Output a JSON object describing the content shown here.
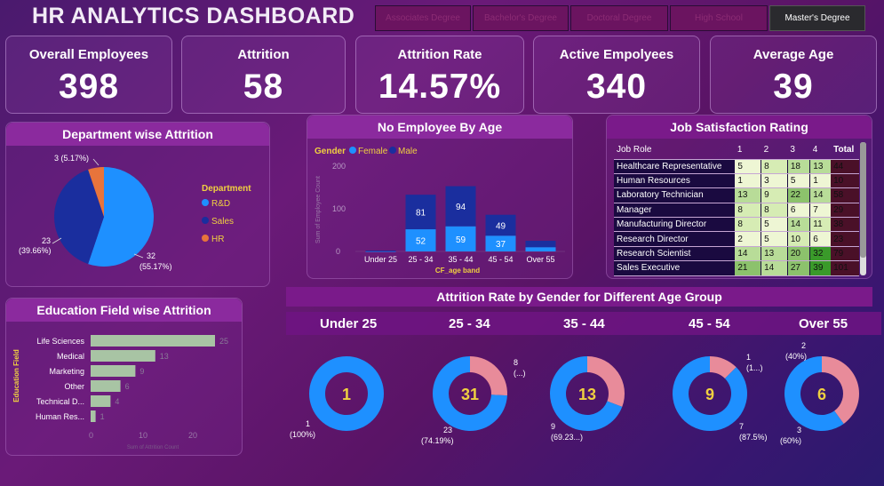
{
  "title": "HR ANALYTICS DASHBOARD",
  "slicers": [
    "Associates Degree",
    "Bachelor's Degree",
    "Doctoral Degree",
    "High School",
    "Master's Degree"
  ],
  "kpis": [
    {
      "label": "Overall Employees",
      "value": "398"
    },
    {
      "label": "Attrition",
      "value": "58"
    },
    {
      "label": "Attrition Rate",
      "value": "14.57%"
    },
    {
      "label": "Active Empolyees",
      "value": "340"
    },
    {
      "label": "Average Age",
      "value": "39"
    }
  ],
  "colors": {
    "rd": "#1e90ff",
    "sales": "#1a2e9e",
    "hr": "#e8743b",
    "female": "#1e90ff",
    "male": "#1a2e9e",
    "attr_yes": "#e88b9a",
    "attr_no": "#1e90ff"
  },
  "dept": {
    "title": "Department wise Attrition",
    "legend_title": "Department",
    "legend": [
      "R&D",
      "Sales",
      "HR"
    ],
    "labels": {
      "rd": "32",
      "rd_pct": "(55.17%)",
      "sales": "23",
      "sales_pct": "(39.66%)",
      "hr": "3 (5.17%)"
    }
  },
  "age": {
    "title": "No Employee By Age",
    "legend_title": "Gender",
    "legend": [
      "Female",
      "Male"
    ],
    "ylabel": "Sum of Employee Count",
    "xlabel": "CF_age band",
    "ticks": [
      "0",
      "100",
      "200"
    ]
  },
  "job": {
    "title": "Job Satisfaction Rating",
    "headers": [
      "Job Role",
      "1",
      "2",
      "3",
      "4",
      "Total"
    ],
    "rows": [
      {
        "role": "Healthcare Representative",
        "v": [
          "5",
          "8",
          "18",
          "13"
        ],
        "t": "44"
      },
      {
        "role": "Human Resources",
        "v": [
          "1",
          "3",
          "5",
          "1"
        ],
        "t": "10"
      },
      {
        "role": "Laboratory Technician",
        "v": [
          "13",
          "9",
          "22",
          "14"
        ],
        "t": "58"
      },
      {
        "role": "Manager",
        "v": [
          "8",
          "8",
          "6",
          "7"
        ],
        "t": "29"
      },
      {
        "role": "Manufacturing Director",
        "v": [
          "8",
          "5",
          "14",
          "11"
        ],
        "t": "38"
      },
      {
        "role": "Research Director",
        "v": [
          "2",
          "5",
          "10",
          "6"
        ],
        "t": "23"
      },
      {
        "role": "Research Scientist",
        "v": [
          "14",
          "13",
          "20",
          "32"
        ],
        "t": "79"
      },
      {
        "role": "Sales Executive",
        "v": [
          "21",
          "14",
          "27",
          "39"
        ],
        "t": "101"
      }
    ]
  },
  "edu": {
    "title": "Education Field wise Attrition",
    "ylabel": "Education Field",
    "xlabel": "Sum of Attrition Count",
    "ticks": [
      "0",
      "10",
      "20"
    ]
  },
  "gender": {
    "title": "Attrition Rate by Gender for Different Age Group",
    "groups": [
      {
        "label": "Under 25",
        "center": "1",
        "lab_a": "1",
        "lab_a2": "(100%)",
        "lab_b": "",
        "lab_b2": ""
      },
      {
        "label": "25 - 34",
        "center": "31",
        "lab_a": "23",
        "lab_a2": "(74.19%)",
        "lab_b": "8",
        "lab_b2": "(...)"
      },
      {
        "label": "35 - 44",
        "center": "13",
        "lab_a": "9",
        "lab_a2": "(69.23...)",
        "lab_b": "",
        "lab_b2": ""
      },
      {
        "label": "45 - 54",
        "center": "9",
        "lab_a": "7",
        "lab_a2": "(87.5%)",
        "lab_b": "1",
        "lab_b2": "(1...)"
      },
      {
        "label": "Over 55",
        "center": "6",
        "lab_a": "3",
        "lab_a2": "(60%)",
        "lab_b": "2",
        "lab_b2": "(40%)"
      }
    ]
  },
  "chart_data": [
    {
      "type": "pie",
      "title": "Department wise Attrition",
      "categories": [
        "R&D",
        "Sales",
        "HR"
      ],
      "values": [
        32,
        23,
        3
      ]
    },
    {
      "type": "bar",
      "title": "No Employee By Age",
      "categories": [
        "Under 25",
        "25 - 34",
        "35 - 44",
        "45 - 54",
        "Over 55"
      ],
      "series": [
        {
          "name": "Female",
          "values": [
            0,
            52,
            59,
            37,
            10
          ]
        },
        {
          "name": "Male",
          "values": [
            2,
            81,
            94,
            49,
            15
          ]
        }
      ],
      "xlabel": "CF_age band",
      "ylabel": "Sum of Employee Count",
      "ylim": [
        0,
        200
      ]
    },
    {
      "type": "bar",
      "title": "Education Field wise Attrition",
      "categories": [
        "Life Sciences",
        "Medical",
        "Marketing",
        "Other",
        "Technical D...",
        "Human Res..."
      ],
      "values": [
        25,
        13,
        9,
        6,
        4,
        1
      ],
      "xlabel": "Sum of Attrition Count",
      "ylabel": "Education Field",
      "xlim": [
        0,
        26
      ]
    },
    {
      "type": "pie",
      "title": "Attrition Rate by Gender for Different Age Group",
      "categories": [
        "Under 25",
        "25 - 34",
        "35 - 44",
        "45 - 54",
        "Over 55"
      ],
      "series": [
        {
          "values": [
            1,
            23,
            9,
            7,
            3
          ]
        },
        {
          "values": [
            0,
            8,
            4,
            1,
            2
          ]
        }
      ]
    }
  ]
}
